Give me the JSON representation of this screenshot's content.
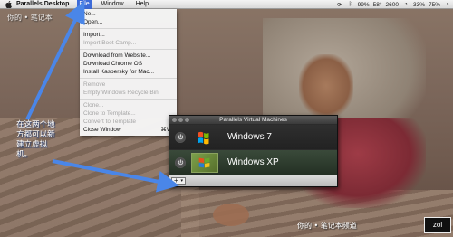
{
  "menubar": {
    "app_name": "Parallels Desktop",
    "menus": [
      "File",
      "Window",
      "Help"
    ],
    "active_menu": "File",
    "status": {
      "battery": "99%",
      "temperature": "58°",
      "speed": "2600",
      "volume": "33%",
      "other": "75%"
    }
  },
  "file_menu": {
    "items": [
      {
        "label": "Ne...",
        "enabled": true
      },
      {
        "label": "Open...",
        "enabled": true
      },
      {
        "label": "Import...",
        "enabled": true
      },
      {
        "label": "Import Boot Camp...",
        "enabled": false
      },
      {
        "label": "Download from Website...",
        "enabled": true
      },
      {
        "label": "Download Chrome OS",
        "enabled": true
      },
      {
        "label": "Install Kaspersky for Mac...",
        "enabled": true
      },
      {
        "label": "Remove",
        "enabled": false
      },
      {
        "label": "Empty Windows Recycle Bin",
        "enabled": false
      },
      {
        "label": "Clone...",
        "enabled": false
      },
      {
        "label": "Clone to Template...",
        "enabled": false
      },
      {
        "label": "Convert to Template",
        "enabled": false
      },
      {
        "label": "Close Window",
        "enabled": true,
        "shortcut": "⌘W"
      }
    ]
  },
  "vm_window": {
    "title": "Parallels Virtual Machines",
    "machines": [
      {
        "name": "Windows 7",
        "icon": "windows-7-logo-icon"
      },
      {
        "name": "Windows XP",
        "icon": "windows-xp-logo-icon"
      }
    ],
    "add_button": "+"
  },
  "annotation": {
    "lines": [
      "在这两个地",
      "方都可以新",
      "建立虚拟",
      "机。"
    ]
  },
  "watermark": {
    "top": "你的 • 笔记本",
    "bottom": "你的 • 笔记本频道",
    "logo": "zol"
  },
  "colors": {
    "menu_highlight": "#3d6bd8",
    "annotation_arrow": "#4a86e8"
  }
}
